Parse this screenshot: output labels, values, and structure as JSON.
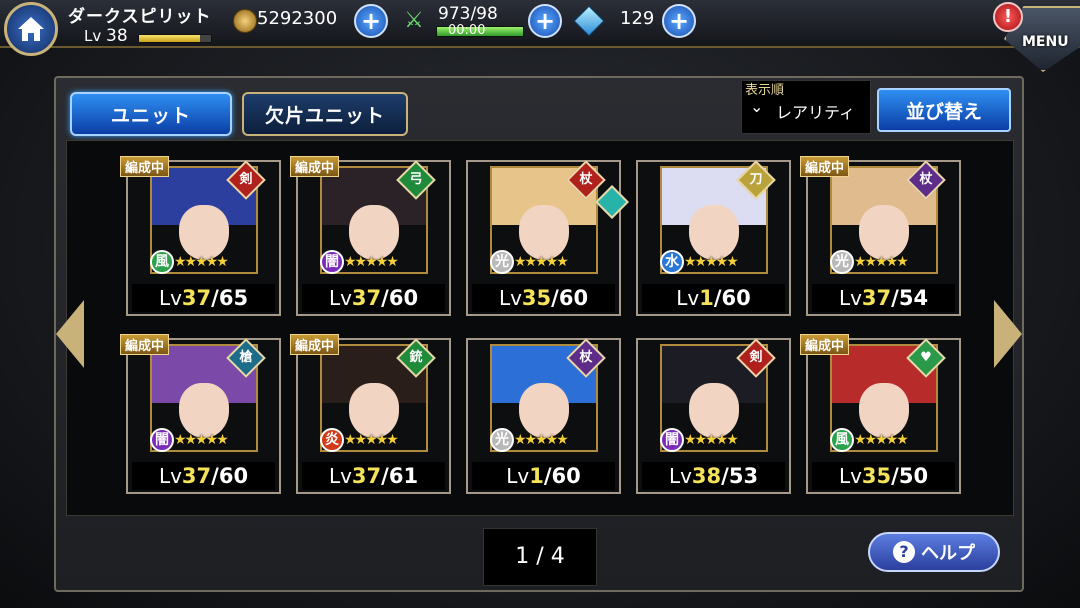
{
  "header": {
    "player_name": "ダークスピリット",
    "level_prefix": "Lv",
    "level": "38",
    "xp_fraction": 0.85,
    "gold": "5292300",
    "stamina": "973/98",
    "stamina_timer": "00:00",
    "gems": "129",
    "menu_label": "MENU",
    "alert_symbol": "!",
    "plus_symbol": "+"
  },
  "tabs": {
    "unit": "ユニット",
    "fragment_unit": "欠片ユニット"
  },
  "sort": {
    "caption": "表示順",
    "value": "レアリティ",
    "chevron": "⌄",
    "button": "並び替え"
  },
  "units": [
    {
      "badge": "編成中",
      "lv_prefix": "Lv",
      "lv": "37",
      "max": "/65",
      "stars": "★★★★★",
      "weapon": "剣",
      "element": "風",
      "hair": "#2c3f9e",
      "elem_color": "#2aa14a",
      "weapon_color": "#b0201c"
    },
    {
      "badge": "編成中",
      "lv_prefix": "Lv",
      "lv": "37",
      "max": "/60",
      "stars": "★★★★★",
      "weapon": "弓",
      "element": "闇",
      "hair": "#2a2226",
      "elem_color": "#7a2bb8",
      "weapon_color": "#1f8a3a"
    },
    {
      "badge": "",
      "lv_prefix": "Lv",
      "lv": "35",
      "max": "/60",
      "stars": "★★★★★",
      "weapon": "杖",
      "element": "光",
      "hair": "#e7c58a",
      "elem_color": "#b8b8b8",
      "weapon_color": "#b0201c"
    },
    {
      "badge": "",
      "lv_prefix": "Lv",
      "lv": "1",
      "max": "/60",
      "stars": "★★★★★",
      "weapon": "刀",
      "element": "水",
      "hair": "#dcdcf2",
      "elem_color": "#2b77d6",
      "weapon_color": "#b9a23a"
    },
    {
      "badge": "編成中",
      "lv_prefix": "Lv",
      "lv": "37",
      "max": "/54",
      "stars": "★★★★★",
      "weapon": "杖",
      "element": "光",
      "hair": "#e0bb8e",
      "elem_color": "#b8b8b8",
      "weapon_color": "#5e2d8a"
    },
    {
      "badge": "編成中",
      "lv_prefix": "Lv",
      "lv": "37",
      "max": "/60",
      "stars": "★★★★★",
      "weapon": "槍",
      "element": "闇",
      "hair": "#7b4aa8",
      "elem_color": "#7a2bb8",
      "weapon_color": "#1d6d8a"
    },
    {
      "badge": "編成中",
      "lv_prefix": "Lv",
      "lv": "37",
      "max": "/61",
      "stars": "★★★★★",
      "weapon": "銃",
      "element": "炎",
      "hair": "#2a1e1a",
      "elem_color": "#d23a1a",
      "weapon_color": "#1f8a3a"
    },
    {
      "badge": "",
      "lv_prefix": "Lv",
      "lv": "1",
      "max": "/60",
      "stars": "★★★★★",
      "weapon": "杖",
      "element": "光",
      "hair": "#2c6fd6",
      "elem_color": "#b8b8b8",
      "weapon_color": "#5e2d8a"
    },
    {
      "badge": "",
      "lv_prefix": "Lv",
      "lv": "38",
      "max": "/53",
      "stars": "★★★★★",
      "weapon": "剣",
      "element": "闇",
      "hair": "#1c1c24",
      "elem_color": "#7a2bb8",
      "weapon_color": "#b0201c"
    },
    {
      "badge": "編成中",
      "lv_prefix": "Lv",
      "lv": "35",
      "max": "/50",
      "stars": "★★★★★",
      "weapon": "♥",
      "element": "風",
      "hair": "#b82b2b",
      "elem_color": "#2aa14a",
      "weapon_color": "#2a9a4a"
    }
  ],
  "pager": "1 / 4",
  "help": {
    "label": "ヘルプ",
    "symbol": "?"
  },
  "icons": {
    "home": "home-icon",
    "gold": "gold-coin-icon",
    "stamina": "crossed-swords-icon",
    "gem": "crystal-icon",
    "alert": "alert-icon",
    "menu": "menu-book-icon"
  }
}
